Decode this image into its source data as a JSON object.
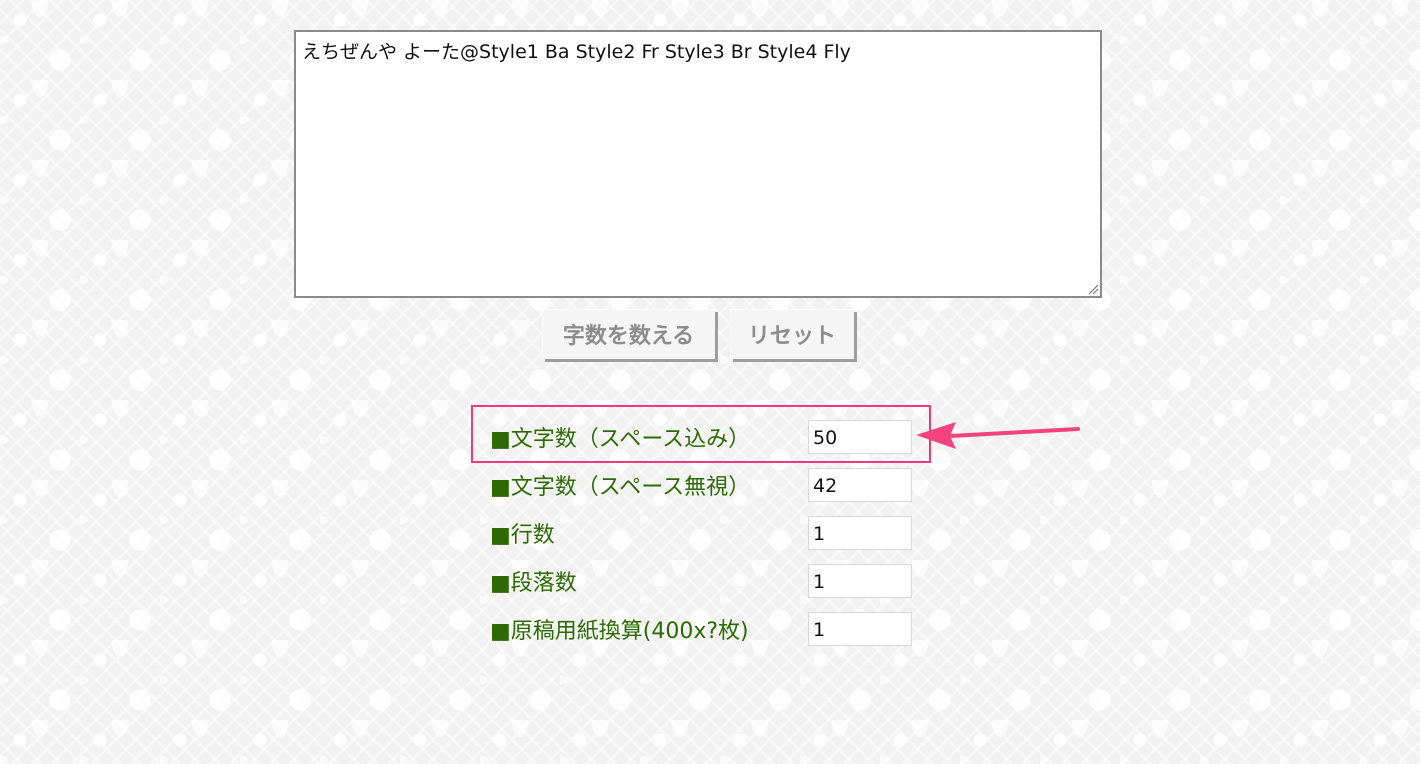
{
  "editor": {
    "text": "えちぜんや よーた@Style1 Ba Style2 Fr Style3 Br Style4 Fly"
  },
  "buttons": {
    "count_label": "字数を数える",
    "reset_label": "リセット"
  },
  "results": [
    {
      "label": "■文字数（スペース込み）",
      "value": "50"
    },
    {
      "label": "■文字数（スペース無視）",
      "value": "42"
    },
    {
      "label": "■行数",
      "value": "1"
    },
    {
      "label": "■段落数",
      "value": "1"
    },
    {
      "label": "■原稿用紙換算(400x?枚)",
      "value": "1"
    }
  ],
  "colors": {
    "label_green": "#2d6a04",
    "highlight_pink": "#ee3a7a",
    "button_text": "#8c8c8c"
  },
  "icons": {
    "resize_grip": "resize-grip-icon",
    "annotation_arrow": "arrow-left-icon"
  }
}
